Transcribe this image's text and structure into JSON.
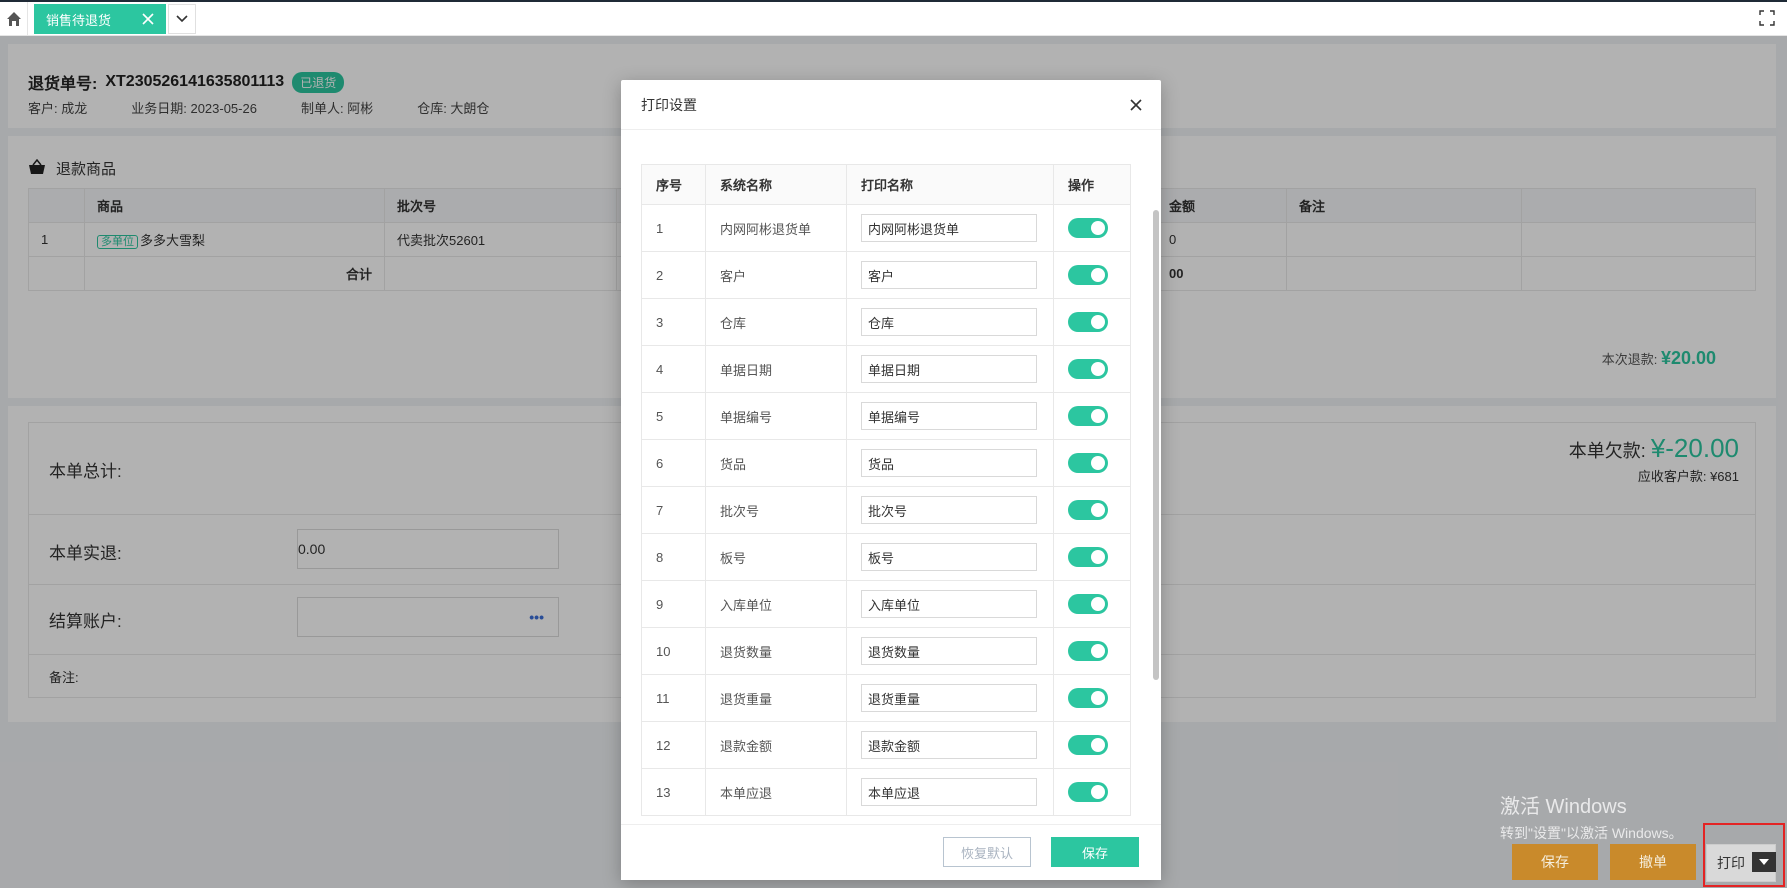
{
  "tab": {
    "title": "销售待退货"
  },
  "header": {
    "order_label": "退货单号:",
    "order_no": "XT230526141635801113",
    "status": "已退货",
    "customer": "客户: 成龙",
    "date": "业务日期: 2023-05-26",
    "maker": "制单人: 阿彬",
    "warehouse": "仓库: 大朗仓"
  },
  "goods": {
    "title": "退款商品",
    "columns": [
      "",
      "商品",
      "批次号",
      "",
      "金额",
      "备注",
      ""
    ],
    "rows": [
      {
        "no": "1",
        "tag": "多单位",
        "name": "多多大雪梨",
        "batch": "代卖批次52601",
        "amount": "0"
      }
    ],
    "total_label": "合计",
    "total_amount": "00",
    "refund_label": "本次退款:",
    "refund_value": "¥20.00"
  },
  "summary": {
    "total_label": "本单总计:",
    "debt_label": "本单欠款:",
    "debt_value": "¥-20.00",
    "receivable": "应收客户款: ¥681",
    "actual_label": "本单实退:",
    "actual_value": "0.00",
    "account_label": "结算账户:",
    "account_more": "•••",
    "remark_label": "备注:"
  },
  "actions": {
    "save": "保存",
    "revoke": "撤单",
    "print": "打印"
  },
  "watermark": {
    "line1": "激活 Windows",
    "line2": "转到\"设置\"以激活 Windows。"
  },
  "modal": {
    "title": "打印设置",
    "headers": [
      "序号",
      "系统名称",
      "打印名称",
      "操作"
    ],
    "rows": [
      {
        "no": "1",
        "sys": "内网阿彬退货单",
        "print": "内网阿彬退货单",
        "on": true
      },
      {
        "no": "2",
        "sys": "客户",
        "print": "客户",
        "on": true
      },
      {
        "no": "3",
        "sys": "仓库",
        "print": "仓库",
        "on": true
      },
      {
        "no": "4",
        "sys": "单据日期",
        "print": "单据日期",
        "on": true
      },
      {
        "no": "5",
        "sys": "单据编号",
        "print": "单据编号",
        "on": true
      },
      {
        "no": "6",
        "sys": "货品",
        "print": "货品",
        "on": true
      },
      {
        "no": "7",
        "sys": "批次号",
        "print": "批次号",
        "on": true
      },
      {
        "no": "8",
        "sys": "板号",
        "print": "板号",
        "on": true
      },
      {
        "no": "9",
        "sys": "入库单位",
        "print": "入库单位",
        "on": true
      },
      {
        "no": "10",
        "sys": "退货数量",
        "print": "退货数量",
        "on": true
      },
      {
        "no": "11",
        "sys": "退货重量",
        "print": "退货重量",
        "on": true
      },
      {
        "no": "12",
        "sys": "退款金额",
        "print": "退款金额",
        "on": true
      },
      {
        "no": "13",
        "sys": "本单应退",
        "print": "本单应退",
        "on": true
      }
    ],
    "reset_label": "恢复默认",
    "save_label": "保存"
  },
  "colors": {
    "accent": "#2cc6a0",
    "action": "#c98a2b",
    "highlight": "#e32424"
  }
}
